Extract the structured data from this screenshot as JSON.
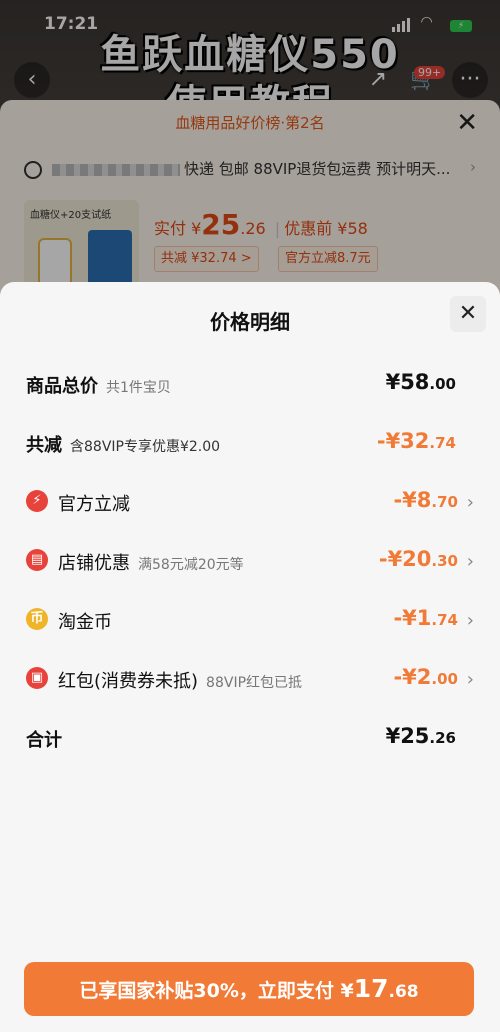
{
  "status_bar": {
    "time": "17:21"
  },
  "video": {
    "title_line1": "鱼跃血糖仪550",
    "title_line2": "使用教程",
    "cart_badge": "99+"
  },
  "sku_panel": {
    "rank": "血糖用品好价榜·第2名",
    "shipping": "快递 包邮 88VIP退货包运费 预计明天...",
    "thumb_label": "血糖仪+20支试纸",
    "price_prefix": "实付 ¥",
    "price_int": "25",
    "price_dec": ".26",
    "orig": "优惠前 ¥58",
    "chip_total": "共减 ¥32.74 >",
    "chip_official": "官方立减8.7元"
  },
  "sheet": {
    "title": "价格明细",
    "rows": [
      {
        "label": "商品总价",
        "sub": "共1件宝贝",
        "int": "¥58",
        "dec": ".00"
      },
      {
        "label": "共减",
        "sub": "含88VIP专享优惠¥2.00",
        "int": "-¥32",
        "dec": ".74"
      },
      {
        "label": "官方立减",
        "sub": "",
        "int": "-¥8",
        "dec": ".70",
        "icon": "lightning-icon"
      },
      {
        "label": "店铺优惠",
        "sub": "满58元减20元等",
        "int": "-¥20",
        "dec": ".30",
        "icon": "store-coupon-icon"
      },
      {
        "label": "淘金币",
        "sub": "",
        "int": "-¥1",
        "dec": ".74",
        "icon": "gold-coin-icon"
      },
      {
        "label": "红包(消费券未抵)",
        "sub": "88VIP红包已抵",
        "int": "-¥2",
        "dec": ".00",
        "icon": "red-packet-icon"
      },
      {
        "label": "合计",
        "sub": "",
        "int": "¥25",
        "dec": ".26"
      }
    ],
    "pay_button": {
      "prefix": "已享国家补贴30%，立即支付 ¥",
      "int": "17",
      "dec": ".68"
    }
  },
  "colors": {
    "accent": "#f07a36",
    "icon_red": "#e8433a",
    "coin": "#f0b429"
  }
}
